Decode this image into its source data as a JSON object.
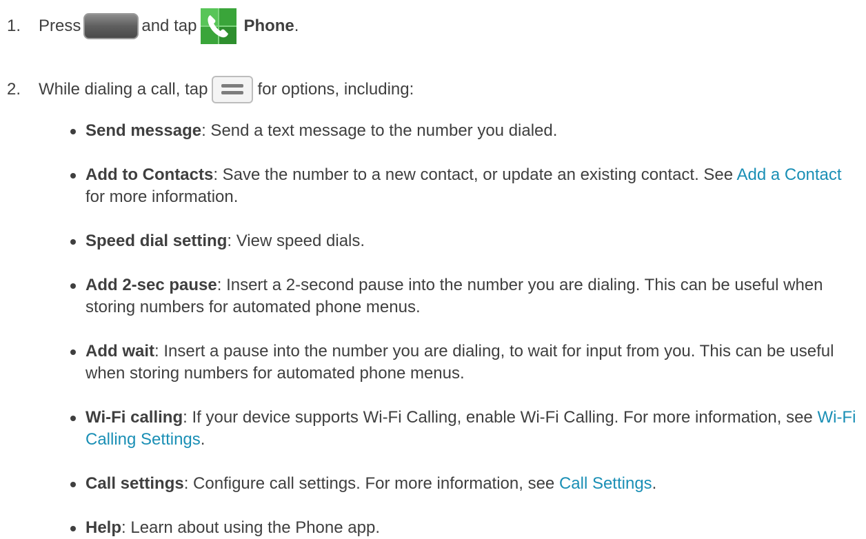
{
  "steps": [
    {
      "number": "1.",
      "text_press": "Press",
      "text_and_tap": "and tap",
      "app_label": "Phone",
      "end": ".",
      "icons": [
        "home-key-icon",
        "phone-app-icon"
      ]
    },
    {
      "number": "2.",
      "text_before": "While dialing a call, tap",
      "text_after": "for options, including:",
      "icons": [
        "menu-key-icon"
      ]
    }
  ],
  "options": [
    {
      "term": "Send message",
      "desc": ": Send a text message to the number you dialed."
    },
    {
      "term": "Add to Contacts",
      "desc": ": Save the number to a new contact, or update an existing contact. See ",
      "link": "Add a Contact",
      "after": " for more information."
    },
    {
      "term": "Speed dial setting",
      "desc": ": View speed dials."
    },
    {
      "term": "Add 2-sec pause",
      "desc": ": Insert a 2-second pause into the number you are dialing. This can be useful when storing numbers for automated phone menus."
    },
    {
      "term": "Add wait",
      "desc": ": Insert a pause into the number you are dialing, to wait for input from you. This can be useful when storing numbers for automated phone menus."
    },
    {
      "term": "Wi-Fi calling",
      "desc": ": If your device supports Wi-Fi Calling, enable Wi-Fi Calling. For more information, see ",
      "link": "Wi-Fi Calling Settings",
      "after": "."
    },
    {
      "term": "Call settings",
      "desc": ": Configure call settings. For more information, see ",
      "link": "Call Settings",
      "after": "."
    },
    {
      "term": "Help",
      "desc": ": Learn about using the Phone app."
    }
  ],
  "colors": {
    "text": "#3f3f3f",
    "link": "#1a8fb5",
    "icon_green": "#3aa53a"
  }
}
